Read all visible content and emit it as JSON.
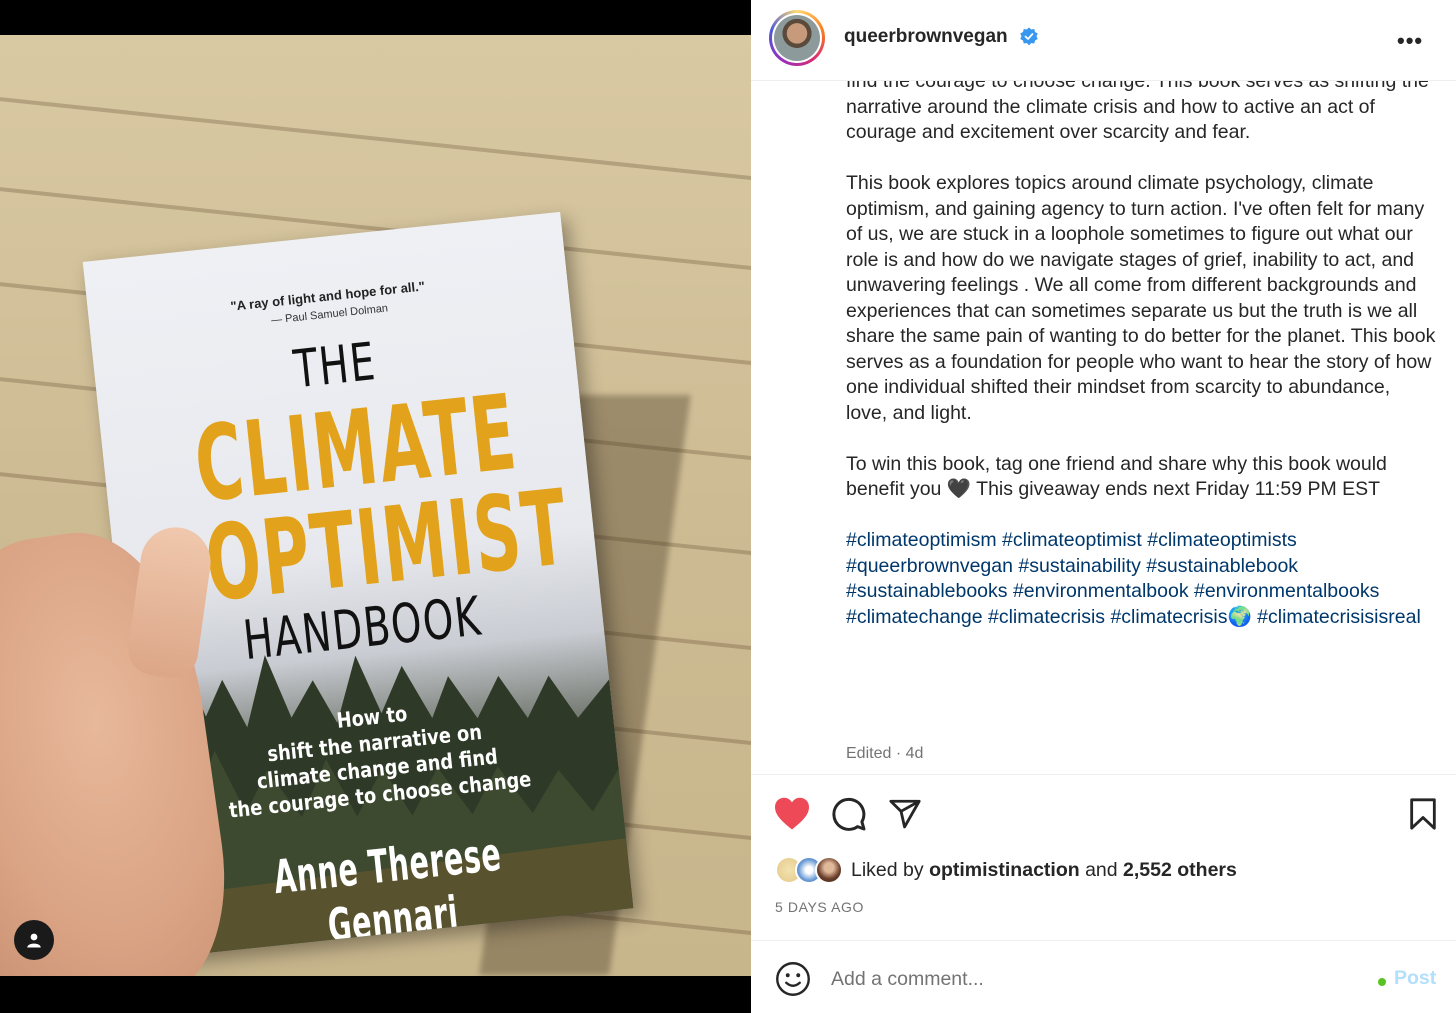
{
  "header": {
    "username": "queerbrownvegan",
    "verified": true,
    "more_icon": "more-horizontal-icon"
  },
  "book_cover": {
    "quote": "\"A ray of light and hope for all.\"",
    "quote_by": "— Paul Samuel Dolman",
    "title_the": "THE",
    "title_climate": "CLIMATE",
    "title_optimist": "OPTIMIST",
    "title_handbook": "HANDBOOK",
    "tagline": "How to\nshift the narrative on\nclimate change and find\nthe courage to choose change",
    "author": "Anne Therese Gennari",
    "accent_color": "#e2a21b"
  },
  "caption": {
    "para1": "find the courage to choose change. This book serves as shifting the narrative around the climate crisis and how to active an act of courage and excitement over scarcity and fear.",
    "para2": "This book explores topics around climate psychology, climate optimism, and gaining agency to turn action. I've often felt for many of us, we are stuck in a loophole sometimes to figure out what our role is and how do we navigate stages of grief, inability to act, and unwavering feelings . We all come from different backgrounds and experiences that can sometimes separate us but the truth is we all share the same pain of wanting to do better for the planet. This book serves as a foundation for people who want to hear the story of how one individual shifted their mindset from scarcity to abundance, love, and light.",
    "para3": "To win this book, tag one friend and share why this book would benefit you 🖤 This giveaway ends next Friday 11:59 PM EST",
    "hashtags": "#climateoptimism #climateoptimist #climateoptimists #queerbrownvegan #sustainability #sustainablebook #sustainablebooks #environmentalbook #environmentalbooks #climatechange #climatecrisis #climatecrisis🌍 #climatecrisisisreal",
    "edited": "Edited · 4d"
  },
  "actions": {
    "like_icon": "heart-filled-icon",
    "comment_icon": "comment-icon",
    "share_icon": "paper-plane-icon",
    "save_icon": "bookmark-icon",
    "liked_color": "#ed4956"
  },
  "likes": {
    "prefix": "Liked by ",
    "user": "optimistinaction",
    "middle": " and ",
    "others": "2,552 others"
  },
  "date": "5 DAYS AGO",
  "comment": {
    "placeholder": "Add a comment...",
    "post_label": "Post",
    "emoji_icon": "smiley-icon"
  }
}
